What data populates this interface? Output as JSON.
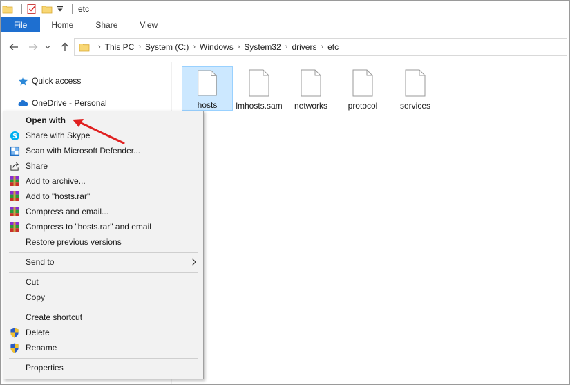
{
  "titlebar": {
    "title": "etc"
  },
  "ribbon": {
    "tabs": [
      "File",
      "Home",
      "Share",
      "View"
    ]
  },
  "address": {
    "crumbs": [
      "This PC",
      "System (C:)",
      "Windows",
      "System32",
      "drivers",
      "etc"
    ]
  },
  "navpane": {
    "quick_access": "Quick access",
    "onedrive": "OneDrive - Personal"
  },
  "files": [
    {
      "name": "hosts",
      "selected": true
    },
    {
      "name": "lmhosts.sam",
      "selected": false
    },
    {
      "name": "networks",
      "selected": false
    },
    {
      "name": "protocol",
      "selected": false
    },
    {
      "name": "services",
      "selected": false
    }
  ],
  "context_menu": {
    "open_with": "Open with",
    "share_skype": "Share with Skype",
    "scan_defender": "Scan with Microsoft Defender...",
    "share": "Share",
    "add_archive": "Add to archive...",
    "add_rar": "Add to \"hosts.rar\"",
    "compress_email": "Compress and email...",
    "compress_rar_email": "Compress to \"hosts.rar\" and email",
    "restore": "Restore previous versions",
    "send_to": "Send to",
    "cut": "Cut",
    "copy": "Copy",
    "create_shortcut": "Create shortcut",
    "delete": "Delete",
    "rename": "Rename",
    "properties": "Properties"
  },
  "colors": {
    "accent": "#1e6fd0",
    "selection": "#cce8ff",
    "arrow": "#e02020"
  }
}
